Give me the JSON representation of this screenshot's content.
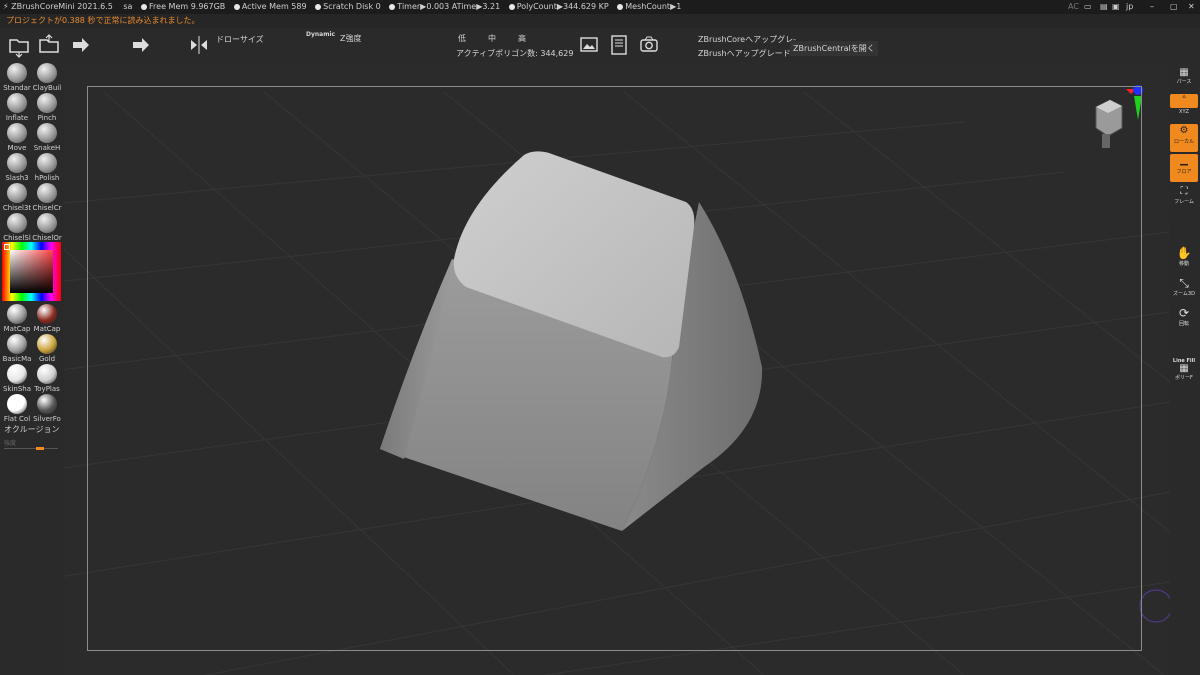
{
  "titlebar": {
    "app": "ZBrushCoreMini 2021.6.5",
    "user": "sa",
    "free_mem": "Free Mem 9.967GB",
    "active_mem": "Active Mem 589",
    "scratch_disk": "Scratch Disk 0",
    "timer": "Timer▶0.003 ATime▶3.21",
    "polycount": "PolyCount▶344.629 KP",
    "meshcount": "MeshCount▶1",
    "right_ac": "AC",
    "lang": "jp"
  },
  "status_message": "プロジェクトが0.388 秒で正常に読み込まれました。",
  "toolbar": {
    "draw_size_label": "ドローサイズ",
    "dynamic_label": "Dynamic",
    "z_intensity_label": "Z強度",
    "low": "低",
    "mid": "中",
    "high": "高",
    "active_polygons": "アクティブポリゴン数: 344,629",
    "upgrade_core": "ZBrushCoreへアップグレ-",
    "upgrade_zbrush": "ZBrushへアップグレード",
    "open_central": "ZBrushCentralを開く",
    "draw_size_level": 0.35,
    "z_intensity_level": 0.45
  },
  "brushes": [
    {
      "name": "Standar"
    },
    {
      "name": "ClayBuil"
    },
    {
      "name": "Inflate"
    },
    {
      "name": "Pinch"
    },
    {
      "name": "Move"
    },
    {
      "name": "SnakeH"
    },
    {
      "name": "Slash3"
    },
    {
      "name": "hPolish"
    },
    {
      "name": "Chisel3t"
    },
    {
      "name": "ChiselCr"
    },
    {
      "name": "ChiselSl"
    },
    {
      "name": "ChiselOr"
    }
  ],
  "materials": [
    {
      "name": "MatCap",
      "color": "#9a9a9a"
    },
    {
      "name": "MatCap",
      "color": "#8a2a1e"
    },
    {
      "name": "BasicMa",
      "color": "#a0a0a0"
    },
    {
      "name": "Gold",
      "color": "#c9a23a"
    },
    {
      "name": "SkinSha",
      "color": "#e6e6e6"
    },
    {
      "name": "ToyPlas",
      "color": "#cfcfcf"
    },
    {
      "name": "Flat Col",
      "color": "#ffffff"
    },
    {
      "name": "SilverFo",
      "color": "#555555"
    }
  ],
  "occlusion_label": "オクルージョン",
  "strength_label": "強度",
  "right_panel": {
    "perspective": "パース",
    "xyz": "XYZ",
    "local": "ローカル",
    "floor": "フロア",
    "frame": "フレーム",
    "move": "移動",
    "zoom": "ズーム3D",
    "rotate": "回転",
    "linefill": "Line Fill",
    "polyf": "ポリーF"
  },
  "colors": {
    "accent": "#f08a1e",
    "bg": "#2b2b2b"
  }
}
